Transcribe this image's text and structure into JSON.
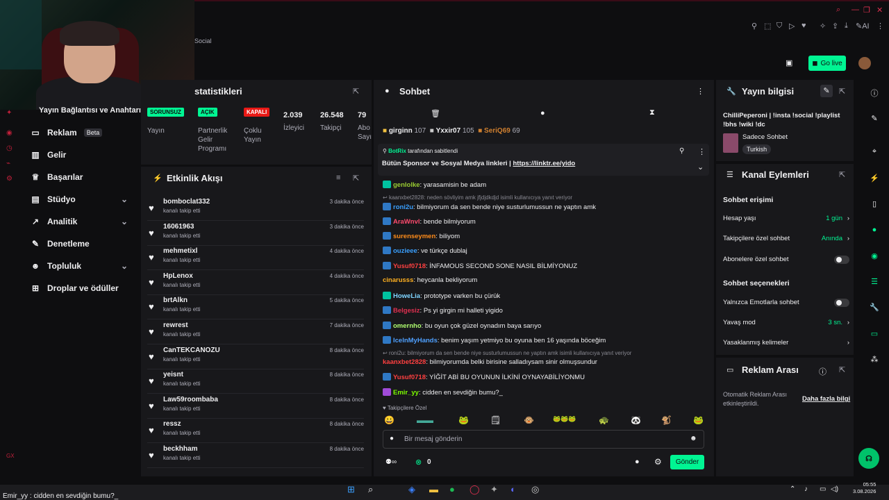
{
  "topbar": {
    "social_label": "Social",
    "go_live": "Go live",
    "ai_label": "AI"
  },
  "sidebar": {
    "connection_label": "Yayın Bağlantısı ve Anahtarı",
    "items": [
      {
        "label": "Reklam",
        "badge": "Beta",
        "icon": "ad-icon"
      },
      {
        "label": "Gelir",
        "icon": "revenue-icon"
      },
      {
        "label": "Başarılar",
        "icon": "trophy-icon"
      },
      {
        "label": "Stüdyo",
        "icon": "studio-icon"
      },
      {
        "label": "Analitik",
        "icon": "analytics-icon"
      },
      {
        "label": "Denetleme",
        "icon": "moderation-icon"
      },
      {
        "label": "Topluluk",
        "icon": "community-icon"
      },
      {
        "label": "Droplar ve ödüller",
        "icon": "drops-icon"
      }
    ]
  },
  "stats": {
    "title": "statistikleri",
    "cols": [
      {
        "pill": "SORUNSUZ",
        "label": "Yayın"
      },
      {
        "pill": "AÇIK",
        "label": "Partnerlik Gelir Programı"
      },
      {
        "pill": "KAPALI",
        "label": "Çoklu Yayın"
      },
      {
        "value": "2.039",
        "label": "İzleyici"
      },
      {
        "value": "26.548",
        "label": "Takipçi"
      },
      {
        "value": "79",
        "label": "Abo Sayı"
      }
    ]
  },
  "feed": {
    "title": "Etkinlik Akışı",
    "items": [
      {
        "name": "bomboclat332",
        "sub": "kanalı takip etti",
        "time": "3 dakika önce"
      },
      {
        "name": "16061963",
        "sub": "kanalı takip etti",
        "time": "3 dakika önce"
      },
      {
        "name": "mehmetixl",
        "sub": "kanalı takip etti",
        "time": "4 dakika önce"
      },
      {
        "name": "HpLenox",
        "sub": "kanalı takip etti",
        "time": "4 dakika önce"
      },
      {
        "name": "brtAlkn",
        "sub": "kanalı takip etti",
        "time": "5 dakika önce"
      },
      {
        "name": "rewrest",
        "sub": "kanalı takip etti",
        "time": "7 dakika önce"
      },
      {
        "name": "CanTEKCANOZU",
        "sub": "kanalı takip etti",
        "time": "8 dakika önce"
      },
      {
        "name": "yeisnt",
        "sub": "kanalı takip etti",
        "time": "8 dakika önce"
      },
      {
        "name": "Law59roombaba",
        "sub": "kanalı takip etti",
        "time": "8 dakika önce"
      },
      {
        "name": "ressz",
        "sub": "kanalı takip etti",
        "time": "8 dakika önce"
      },
      {
        "name": "beckhham",
        "sub": "kanalı takip etti",
        "time": "8 dakika önce"
      }
    ]
  },
  "chat": {
    "title": "Sohbet",
    "top_gifters": [
      {
        "name": "girginn",
        "count": "107"
      },
      {
        "name": "Yxxir07",
        "count": "105"
      },
      {
        "name": "SeriQ69",
        "count": "69"
      }
    ],
    "pinned_by": "BotRix",
    "pinned_note": "tarafından sabitlendi",
    "pinned_text": "Bütün Sponsor ve Sosyal Medya linkleri |",
    "pinned_link": "https://linktr.ee/yido",
    "messages": [
      {
        "user": "genlolke",
        "color": "#9acd32",
        "text": ": yarasamisin be adam",
        "badge": "g"
      },
      {
        "reply": "kaanxbet2828: neden sövliyim amk jfjdjdkdjd isimli kullanıcıya yanıt veriyor"
      },
      {
        "user": "roni2u",
        "color": "#3aa0ff",
        "text": ": bilmiyorum da sen bende niye susturlumussun ne yaptın amk",
        "badge": "b"
      },
      {
        "user": "AraWnvl",
        "color": "#ff4b6e",
        "text": ": bende bilmiyorum",
        "badge": "b"
      },
      {
        "user": "surenseymen",
        "color": "#ff8c1a",
        "text": ": biliyom",
        "badge": "b"
      },
      {
        "user": "ouzieee",
        "color": "#3aa0ff",
        "text": ": ve türkçe dublaj",
        "badge": "b"
      },
      {
        "user": "Yusuf0718",
        "color": "#ff4040",
        "text": ": İNFAMOUS SECOND SONE NASIL BİLMİYONUZ",
        "badge": "b"
      },
      {
        "user": "cinarusss",
        "color": "#ffb020",
        "text": ": heycanla bekliyorum",
        "badge": ""
      },
      {
        "user": "HoweLia",
        "color": "#7fd4ff",
        "text": ": prototype varken bu çürük",
        "badge": "g"
      },
      {
        "user": "Belgesiz",
        "color": "#e03050",
        "text": ": Ps yi girgin mi halleti yigido",
        "badge": "b"
      },
      {
        "user": "omernho",
        "color": "#b0ff70",
        "text": ": bu oyun çok güzel oynadım baya sarıyo",
        "badge": "b"
      },
      {
        "user": "IcelnMyHands",
        "color": "#4fa0ff",
        "text": ": benim yaşım yetmiyo bu oyuna ben 16 yaşında böceğim",
        "badge": "b"
      },
      {
        "reply": "roni2u: bilmiyorum da sen bende niye susturlumussun ne yaptın amk isimli kullanıcıya yanıt veriyor"
      },
      {
        "user": "kaanxbet2828",
        "color": "#ff4040",
        "text": ": bilmiyorumda belki birisine salladıysam sinir olmuşsundur",
        "badge": ""
      },
      {
        "user": "Yusuf0718",
        "color": "#ff4040",
        "text": ": YİĞİT ABİ BU OYUNUN İLKİNİ OYNAYABİLİYONMU",
        "badge": "b"
      },
      {
        "user": "Emir_yy",
        "color": "#7cfc00",
        "text": ": cidden en sevdiğin bumu?_",
        "badge": "p"
      }
    ],
    "followers_only": "Takipçilere Özel",
    "input_placeholder": "Bir mesaj gönderin",
    "points": "0",
    "send": "Gönder"
  },
  "stream_info": {
    "title": "Yayın bilgisi",
    "stream_title": "ChilliPeperoni | !insta !social !playlist !bhs !wiki !dc",
    "category": "Sadece Sohbet",
    "language": "Turkish"
  },
  "channel_actions": {
    "title": "Kanal Eylemleri",
    "chat_access": "Sohbet erişimi",
    "account_age": "Hesap yaşı",
    "account_age_val": "1 gün",
    "followers_chat": "Takipçilere özel sohbet",
    "followers_chat_val": "Anında",
    "subs_chat": "Abonelere özel sohbet",
    "chat_options": "Sohbet seçenekleri",
    "emote_only": "Yalnızca Emotlarla sohbet",
    "slow_mode": "Yavaş mod",
    "slow_mode_val": "3 sn.",
    "banned_words": "Yasaklanmış kelimeler"
  },
  "ad_break": {
    "title": "Reklam Arası",
    "text": "Otomatik Reklam Arası etkinleştirildi.",
    "link": "Daha fazla bilgi"
  },
  "taskbar": {
    "caption": "Emir_yy : cidden en sevdiğin bumu?_",
    "time": "05:55",
    "date": "3.08.2026"
  }
}
